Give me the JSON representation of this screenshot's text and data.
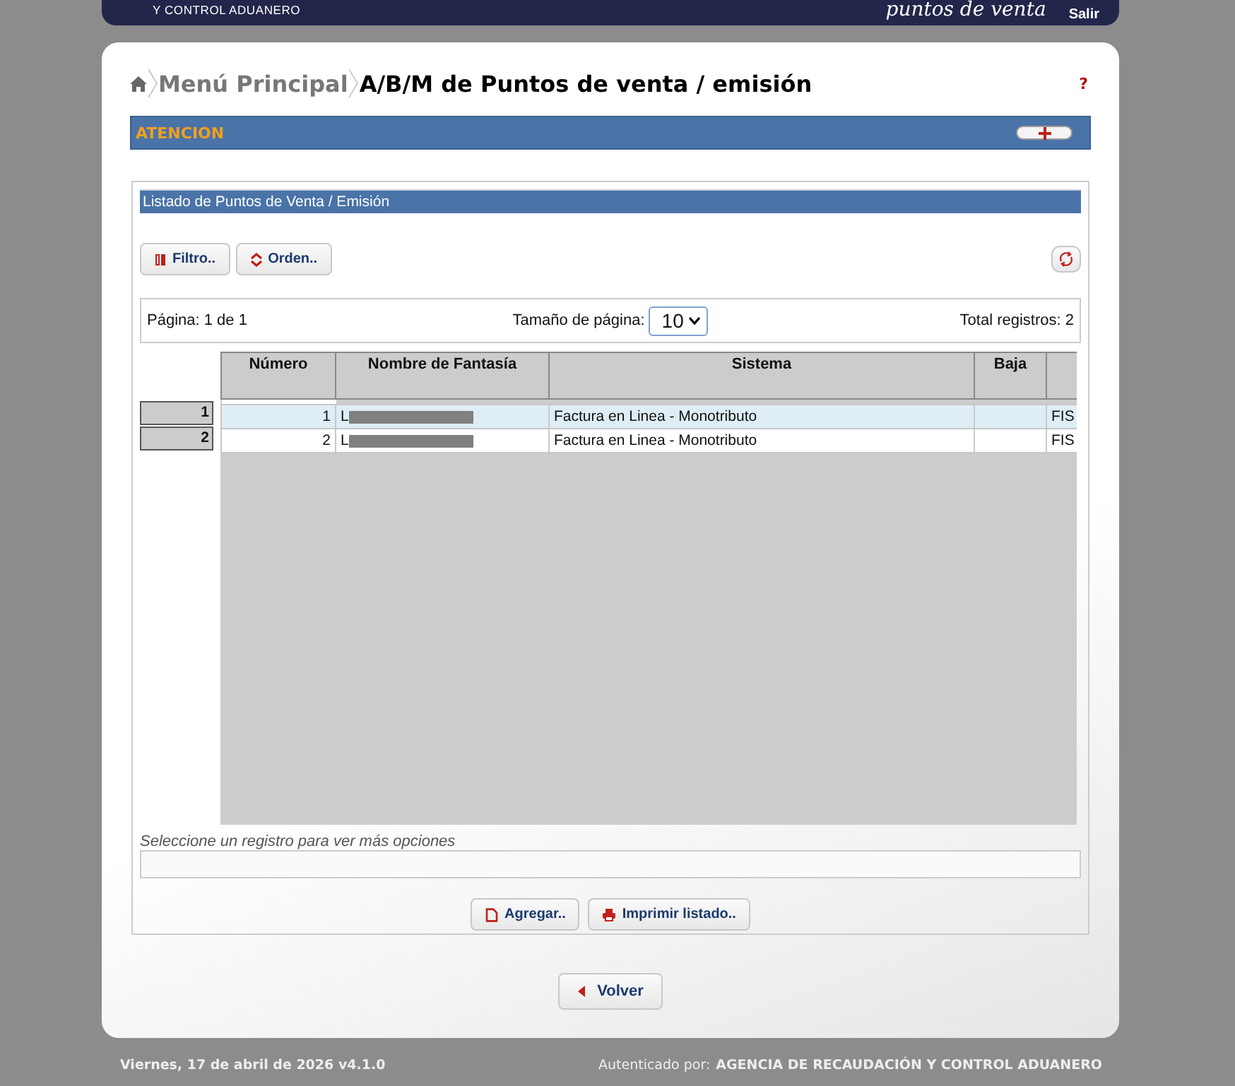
{
  "header": {
    "org_line": "Y CONTROL ADUANERO",
    "app_title": "puntos de venta",
    "logout": "Salir"
  },
  "breadcrumb": [
    {
      "label": "Menú Principal",
      "current": false
    },
    {
      "label": "A/B/M de Puntos de venta / emisión",
      "current": true
    }
  ],
  "help": "?",
  "alert_bar": {
    "title": "ATENCION"
  },
  "listing": {
    "title": "Listado de Puntos de Venta / Emisión",
    "toolbar": [
      {
        "label": "Filtro..",
        "kind": "filter"
      },
      {
        "label": "Orden..",
        "kind": "sort"
      }
    ],
    "pager": {
      "page": "Página: 1 de 1",
      "page_size_label": "Tamaño de página:",
      "page_size": "10",
      "total": "Total registros: 2"
    },
    "columns": [
      "Número",
      "Nombre de Fantasía",
      "Sistema",
      "Baja"
    ],
    "rows": [
      {
        "index": "1",
        "selected": true,
        "numero": "1",
        "nombre": "L",
        "redacted": true,
        "sistema": "Factura en Linea - Monotributo",
        "column_5": "FIS"
      },
      {
        "index": "2",
        "selected": false,
        "numero": "2",
        "nombre": "L",
        "redacted": true,
        "sistema": "Factura en Linea - Monotributo",
        "column_5": "FIS"
      }
    ],
    "hint": "Seleccione un registro para ver más opciones",
    "actions": [
      {
        "label": "Agregar..",
        "kind": "new"
      },
      {
        "label": "Imprimir listado..",
        "kind": "print"
      }
    ]
  },
  "back": "Volver",
  "footer": {
    "date": "Viernes, 17 de abril de 2026 v4.1.0",
    "auth_label": "Autenticado por:",
    "auth_entity": "AGENCIA DE RECAUDACIÓN Y CONTROL ADUANERO"
  }
}
